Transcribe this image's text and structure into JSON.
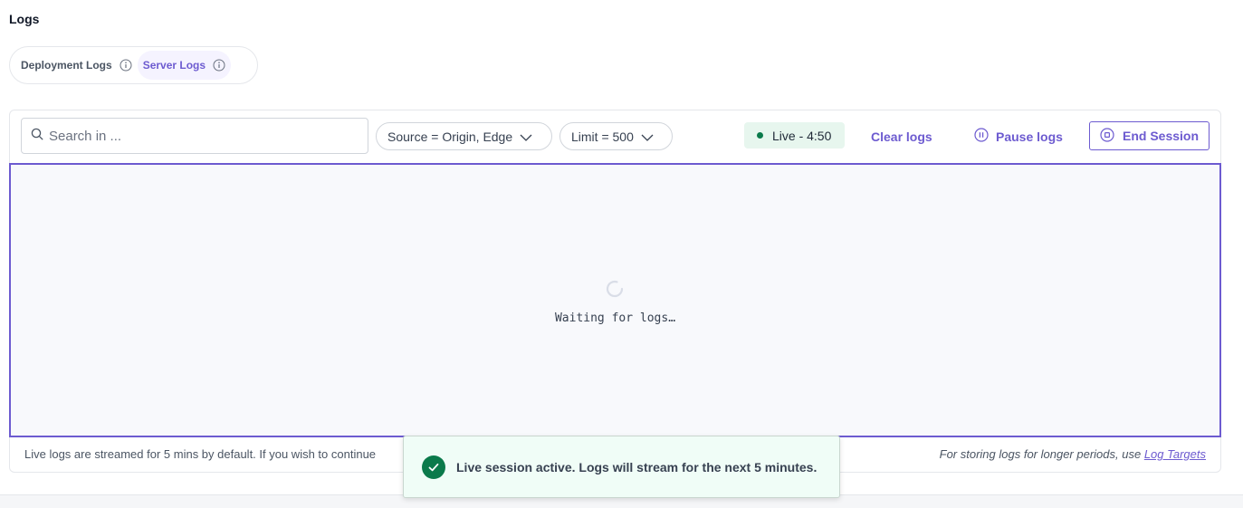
{
  "page": {
    "title": "Logs"
  },
  "tabs": [
    {
      "label": "Deployment Logs",
      "icon": "info-icon",
      "active": false
    },
    {
      "label": "Server Logs",
      "icon": "info-icon",
      "active": true
    }
  ],
  "toolbar": {
    "search": {
      "placeholder": "Search in ...",
      "value": "",
      "icon": "search-icon"
    },
    "source_filter": {
      "label": "Source = Origin, Edge",
      "icon": "chevron-down-icon"
    },
    "limit_filter": {
      "label": "Limit = 500",
      "icon": "chevron-down-icon"
    },
    "live_badge": {
      "label": "Live - 4:50",
      "dot_color": "#0b7a4b"
    },
    "clear_label": "Clear logs",
    "pause_label": "Pause logs",
    "end_session_label": "End Session"
  },
  "log_area": {
    "waiting_text": "Waiting for logs…"
  },
  "footer": {
    "left_text": "Live logs are streamed for 5 mins by default. If you wish to continue",
    "right_text": "For storing logs for longer periods, use",
    "right_link": "Log Targets"
  },
  "toast": {
    "message": "Live session active. Logs will stream for the next 5 minutes.",
    "icon": "check-circle-icon"
  },
  "colors": {
    "accent": "#6d5bd0",
    "success": "#0b7a4b",
    "live_bg": "#e7f6ee",
    "log_bg": "#f8f9fc"
  }
}
